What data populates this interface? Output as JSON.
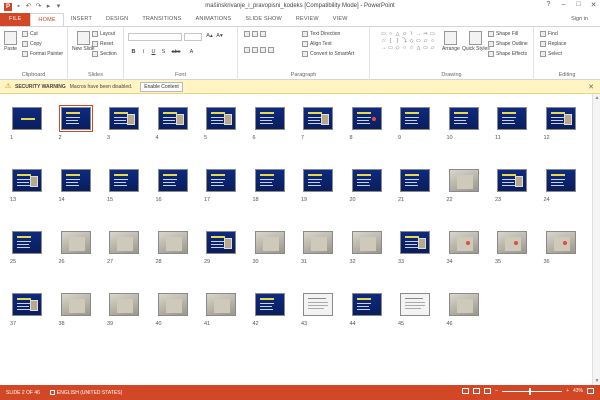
{
  "window": {
    "title": "mašinskrivanje_i_pravopisni_kodeks [Compatibility Mode] - PowerPoint",
    "controls": [
      "?",
      "–",
      "□",
      "✕"
    ]
  },
  "qat": {
    "app_icon": "P",
    "icons": [
      "save-icon",
      "undo-icon",
      "redo-icon",
      "start-from-beginning-icon",
      "customize-icon"
    ],
    "glyphs": [
      "▪",
      "↶",
      "↷",
      "▸",
      "▾"
    ]
  },
  "tabs": [
    "FILE",
    "HOME",
    "INSERT",
    "DESIGN",
    "TRANSITIONS",
    "ANIMATIONS",
    "SLIDE SHOW",
    "REVIEW",
    "VIEW"
  ],
  "active_tab_index": 1,
  "signin": "Sign in",
  "ribbon": {
    "clipboard": {
      "label": "Clipboard",
      "paste": "Paste",
      "cut": "Cut",
      "copy": "Copy",
      "format_painter": "Format Painter"
    },
    "slides": {
      "label": "Slides",
      "new_slide": "New Slide",
      "layout": "Layout",
      "reset": "Reset",
      "section": "Section"
    },
    "font": {
      "label": "Font",
      "bold": "B",
      "italic": "I",
      "underline": "U",
      "strike": "S",
      "shadow": "abc",
      "aa": "A",
      "grow": "A▴",
      "shrink": "A▾"
    },
    "paragraph": {
      "label": "Paragraph",
      "text_direction": "Text Direction",
      "align_text": "Align Text",
      "convert_smartart": "Convert to SmartArt"
    },
    "drawing": {
      "label": "Drawing",
      "arrange": "Arrange",
      "quick_styles": "Quick Styles",
      "shape_fill": "Shape Fill",
      "shape_outline": "Shape Outline",
      "shape_effects": "Shape Effects",
      "shapes": [
        "▭",
        "○",
        "△",
        "▱",
        "\\",
        "→",
        "⇒",
        "▭",
        "☆",
        "{",
        "}",
        "⤵",
        "◇",
        "▭",
        "▱",
        "○",
        "→",
        "▭",
        "◇",
        "○",
        "☆",
        "△",
        "▭",
        "▱"
      ]
    },
    "editing": {
      "label": "Editing",
      "find": "Find",
      "replace": "Replace",
      "select": "Select"
    }
  },
  "security_bar": {
    "title": "SECURITY WARNING",
    "message": "Macros have been disabled.",
    "button": "Enable Content",
    "close": "✕"
  },
  "slides": [
    {
      "n": "1",
      "type": "title"
    },
    {
      "n": "2",
      "type": "text"
    },
    {
      "n": "3",
      "type": "text-pic"
    },
    {
      "n": "4",
      "type": "text-pic"
    },
    {
      "n": "5",
      "type": "text-pic"
    },
    {
      "n": "6",
      "type": "text"
    },
    {
      "n": "7",
      "type": "text-pic"
    },
    {
      "n": "8",
      "type": "text-dot"
    },
    {
      "n": "9",
      "type": "text"
    },
    {
      "n": "10",
      "type": "text"
    },
    {
      "n": "11",
      "type": "text"
    },
    {
      "n": "12",
      "type": "text-pic"
    },
    {
      "n": "13",
      "type": "text-pic"
    },
    {
      "n": "14",
      "type": "text"
    },
    {
      "n": "15",
      "type": "text"
    },
    {
      "n": "16",
      "type": "text"
    },
    {
      "n": "17",
      "type": "text"
    },
    {
      "n": "18",
      "type": "text"
    },
    {
      "n": "19",
      "type": "text"
    },
    {
      "n": "20",
      "type": "text"
    },
    {
      "n": "21",
      "type": "text"
    },
    {
      "n": "22",
      "type": "photo"
    },
    {
      "n": "23",
      "type": "text-pic"
    },
    {
      "n": "24",
      "type": "text"
    },
    {
      "n": "25",
      "type": "text"
    },
    {
      "n": "26",
      "type": "photo"
    },
    {
      "n": "27",
      "type": "photo"
    },
    {
      "n": "28",
      "type": "photo"
    },
    {
      "n": "29",
      "type": "text-pic"
    },
    {
      "n": "30",
      "type": "photo"
    },
    {
      "n": "31",
      "type": "photo"
    },
    {
      "n": "32",
      "type": "photo"
    },
    {
      "n": "33",
      "type": "text-pic"
    },
    {
      "n": "34",
      "type": "photo-dot"
    },
    {
      "n": "35",
      "type": "photo-dot"
    },
    {
      "n": "36",
      "type": "photo-dot"
    },
    {
      "n": "37",
      "type": "text-pic"
    },
    {
      "n": "38",
      "type": "photo"
    },
    {
      "n": "39",
      "type": "photo"
    },
    {
      "n": "40",
      "type": "photo"
    },
    {
      "n": "41",
      "type": "photo"
    },
    {
      "n": "42",
      "type": "text"
    },
    {
      "n": "43",
      "type": "white"
    },
    {
      "n": "44",
      "type": "text"
    },
    {
      "n": "45",
      "type": "white"
    },
    {
      "n": "46",
      "type": "photo"
    }
  ],
  "selected_slide": "2",
  "status": {
    "slide": "SLIDE 2 OF 46",
    "language": "ENGLISH (UNITED STATES)",
    "zoom": "43%",
    "zoom_fraction": 0.45
  }
}
